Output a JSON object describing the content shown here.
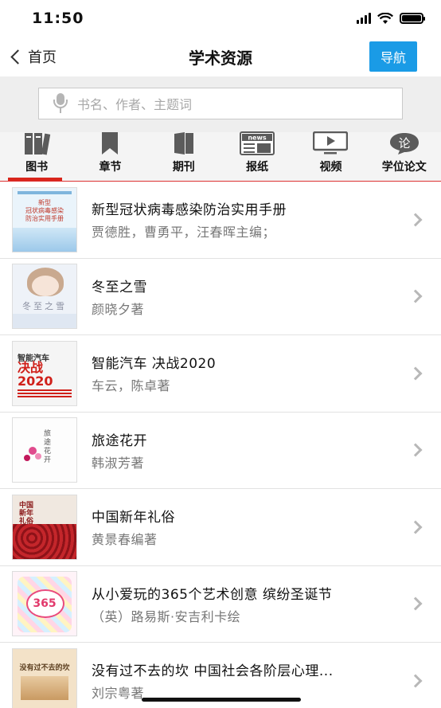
{
  "status": {
    "time": "11:50"
  },
  "nav": {
    "back_label": "首页",
    "title": "学术资源",
    "guide_label": "导航"
  },
  "search": {
    "placeholder": "书名、作者、主题词"
  },
  "tabs": [
    {
      "label": "图书",
      "icon": "books-icon",
      "active": true
    },
    {
      "label": "章节",
      "icon": "bookmark-icon",
      "active": false
    },
    {
      "label": "期刊",
      "icon": "journal-icon",
      "active": false
    },
    {
      "label": "报纸",
      "icon": "newspaper-icon",
      "active": false,
      "icon_text": "news"
    },
    {
      "label": "视频",
      "icon": "video-icon",
      "active": false
    },
    {
      "label": "学位论文",
      "icon": "thesis-icon",
      "active": false,
      "icon_text": "论"
    }
  ],
  "books": [
    {
      "title": "新型冠状病毒感染防治实用手册",
      "author": "贾德胜，曹勇平，汪春晖主编；",
      "cover_color": "#cde6f5",
      "cover_text": [
        "新型",
        "冠状病毒感染",
        "防治实用手册"
      ]
    },
    {
      "title": "冬至之雪",
      "author": "颜晓夕著",
      "cover_color": "#e8eef6",
      "cover_text": [
        "冬至之雪"
      ]
    },
    {
      "title": "智能汽车 决战2020",
      "author": "车云，陈卓著",
      "cover_color": "#f4f4f4",
      "cover_text": [
        "智能汽车",
        "决战",
        "2020"
      ]
    },
    {
      "title": "旅途花开",
      "author": "韩淑芳著",
      "cover_color": "#fbfbfb",
      "cover_text": [
        "旅途花开"
      ]
    },
    {
      "title": "中国新年礼俗",
      "author": "黄景春编著",
      "cover_color": "#c4262b",
      "cover_text": [
        "中国",
        "新年",
        "礼俗"
      ]
    },
    {
      "title": "从小爱玩的365个艺术创意 缤纷圣诞节",
      "author": "（英）路易斯·安吉利卡绘",
      "cover_color": "#fef3f7",
      "cover_text": [
        "365"
      ]
    },
    {
      "title": "没有过不去的坎 中国社会各阶层心理...",
      "author": "刘宗粤著",
      "cover_color": "#f3e2c8",
      "cover_text": [
        "没有过不去的坎"
      ]
    }
  ],
  "colors": {
    "accent_blue": "#1a9be6",
    "tab_red": "#d9251c"
  }
}
